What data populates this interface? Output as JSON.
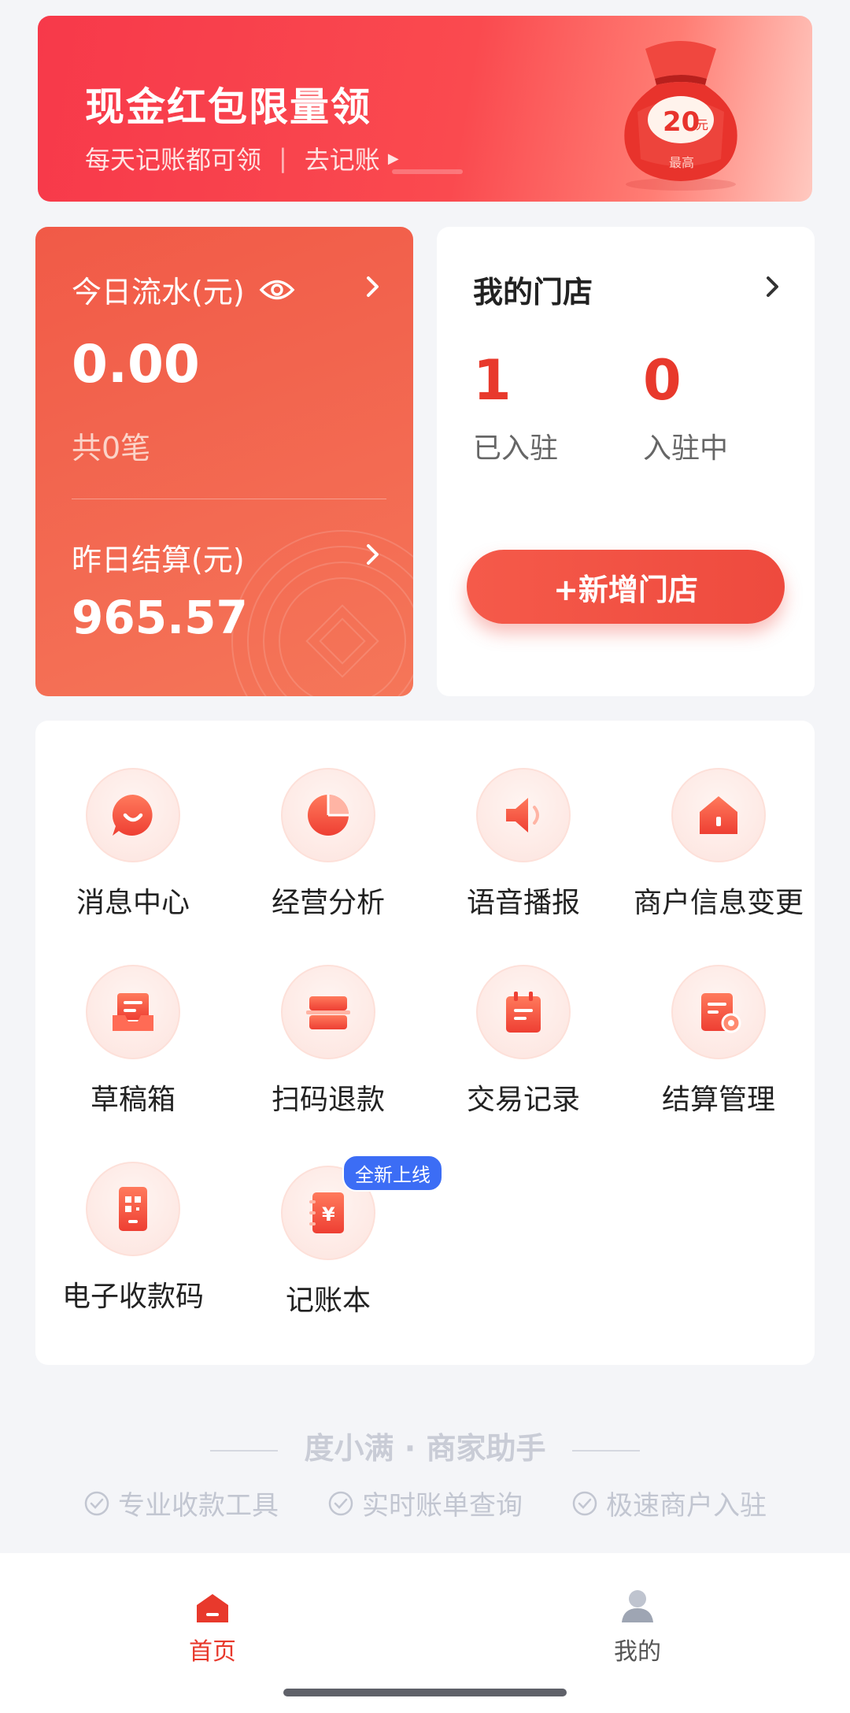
{
  "banner": {
    "title": "现金红包限量领",
    "subtitle": "每天记账都可领",
    "separator": "|",
    "link": "去记账",
    "amount": "20",
    "amount_unit": "元",
    "tag": "最高"
  },
  "today_flow": {
    "title": "今日流水(元)",
    "amount": "0.00",
    "count": "共0笔",
    "yesterday_title": "昨日结算(元)",
    "yesterday_amount": "965.57"
  },
  "stores": {
    "title": "我的门店",
    "settled_count": "1",
    "settled_label": "已入驻",
    "pending_count": "0",
    "pending_label": "入驻中",
    "add_button": "+新增门店"
  },
  "grid": [
    {
      "label": "消息中心",
      "icon": "message-icon"
    },
    {
      "label": "经营分析",
      "icon": "pie-chart-icon"
    },
    {
      "label": "语音播报",
      "icon": "speaker-icon"
    },
    {
      "label": "商户信息变更",
      "icon": "house-icon"
    },
    {
      "label": "草稿箱",
      "icon": "draft-box-icon"
    },
    {
      "label": "扫码退款",
      "icon": "scan-refund-icon"
    },
    {
      "label": "交易记录",
      "icon": "calendar-note-icon"
    },
    {
      "label": "结算管理",
      "icon": "settlement-doc-icon"
    },
    {
      "label": "电子收款码",
      "icon": "qr-code-icon"
    },
    {
      "label": "记账本",
      "icon": "ledger-icon",
      "badge": "全新上线"
    }
  ],
  "footer": {
    "brand": "度小满 · 商家助手",
    "features": [
      "专业收款工具",
      "实时账单查询",
      "极速商户入驻"
    ]
  },
  "tabbar": {
    "home": "首页",
    "me": "我的"
  },
  "colors": {
    "accent": "#e8392c",
    "badge": "#3c6df5"
  }
}
